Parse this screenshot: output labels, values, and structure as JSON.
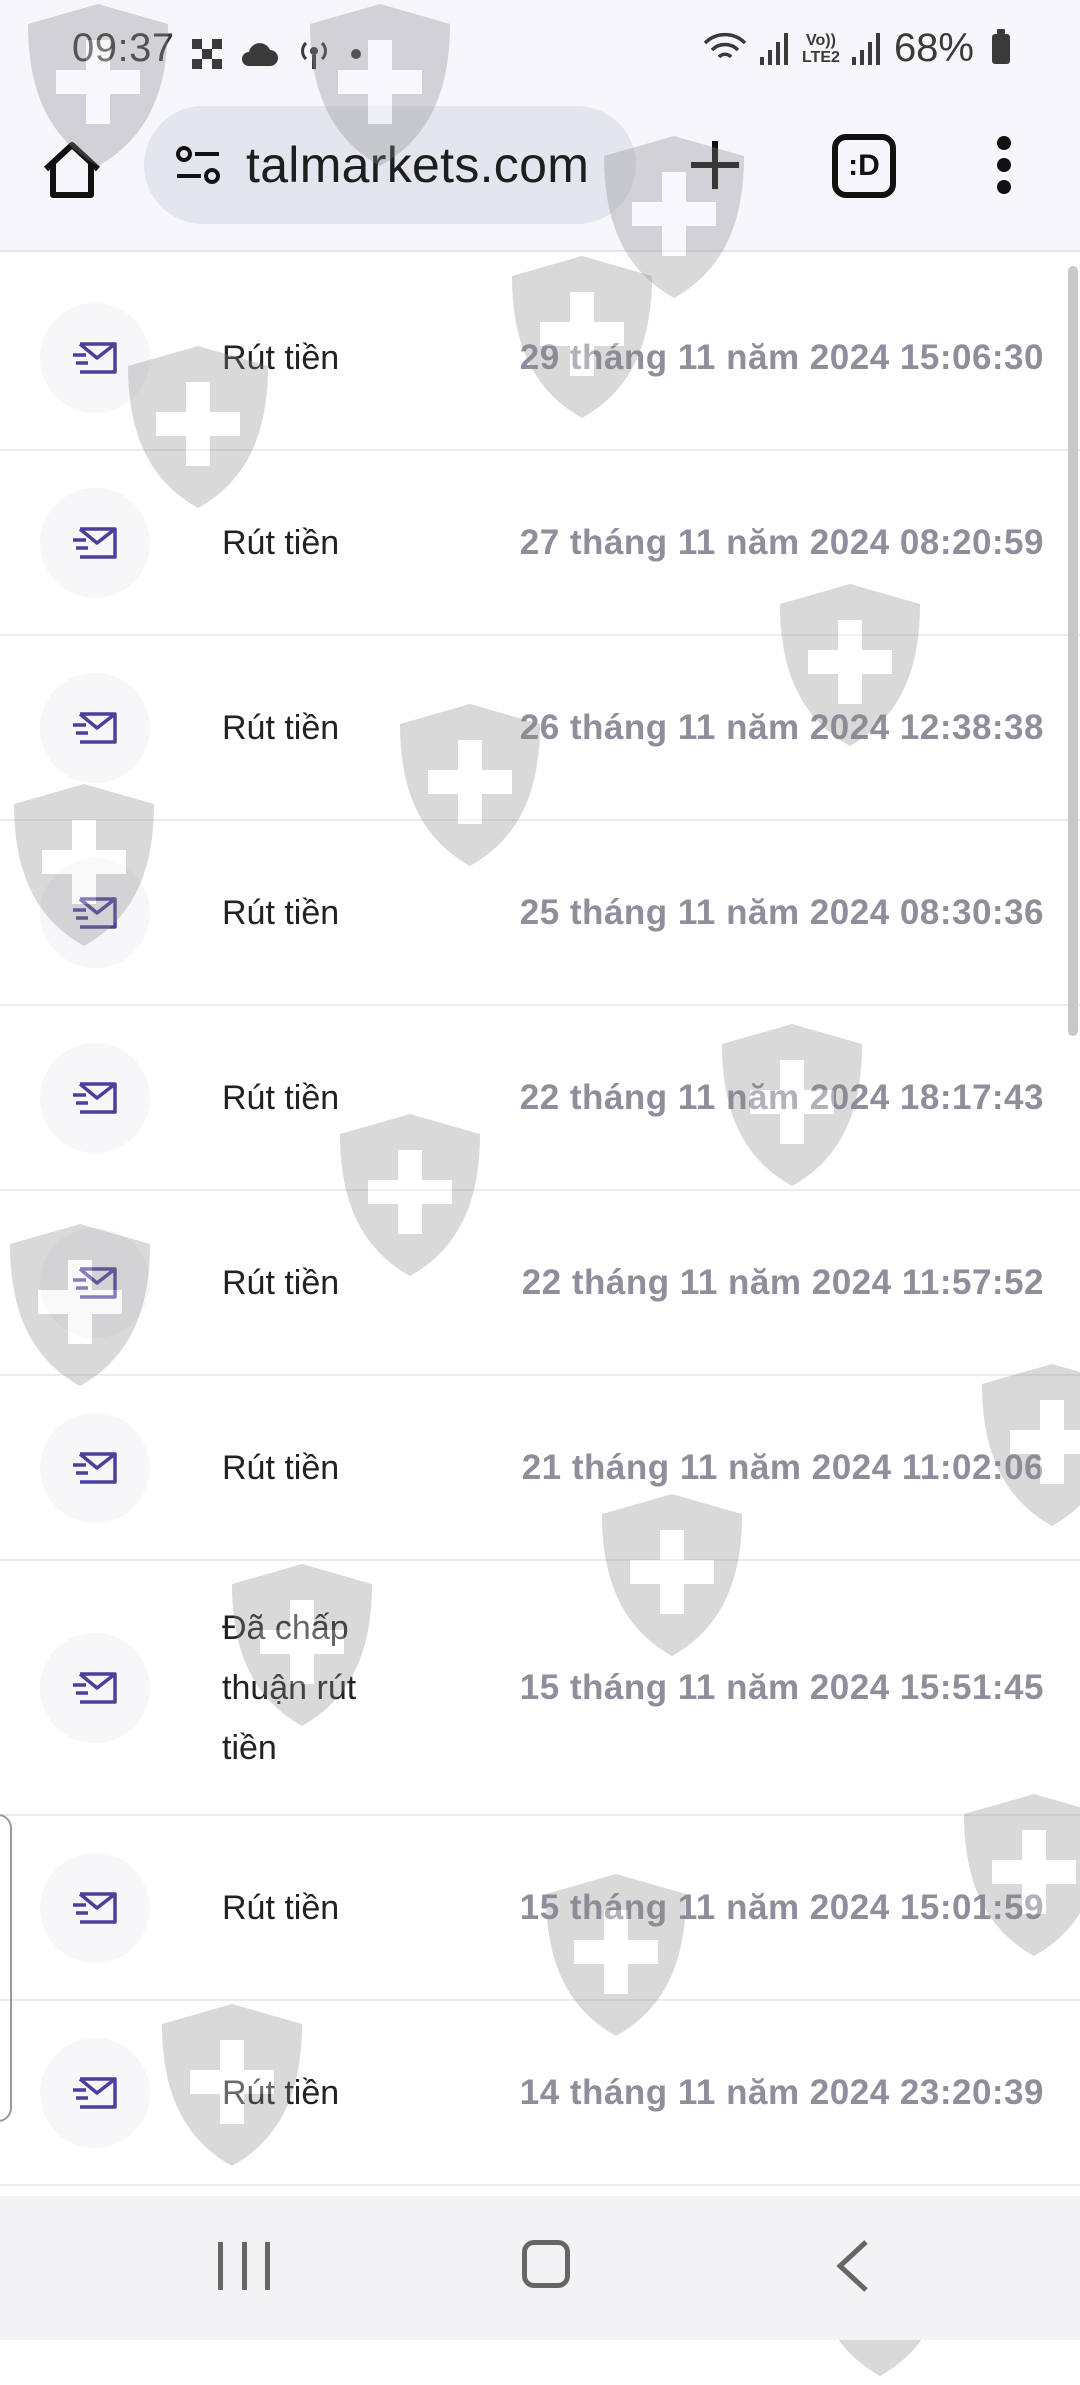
{
  "status_bar": {
    "time": "09:37",
    "battery": "68%",
    "network": "LTE2",
    "network_prefix": "Vo))"
  },
  "browser": {
    "url": "talmarkets.com",
    "tabs_badge": ":D",
    "icons": [
      "home-icon",
      "site-settings-icon",
      "plus-icon",
      "tabs-icon",
      "more-vert-icon"
    ]
  },
  "messages": [
    {
      "label": "Rút tiền",
      "date": "29 tháng 11 năm 2024 15:06:30"
    },
    {
      "label": "Rút tiền",
      "date": "27 tháng 11 năm 2024 08:20:59"
    },
    {
      "label": "Rút tiền",
      "date": "26 tháng 11 năm 2024 12:38:38"
    },
    {
      "label": "Rút tiền",
      "date": "25 tháng 11 năm 2024 08:30:36"
    },
    {
      "label": "Rút tiền",
      "date": "22 tháng 11 năm 2024 18:17:43"
    },
    {
      "label": "Rút tiền",
      "date": "22 tháng 11 năm 2024 11:57:52"
    },
    {
      "label": "Rút tiền",
      "date": "21 tháng 11 năm 2024 11:02:06"
    },
    {
      "label": "Đã chấp thuận rút tiền",
      "date": "15 tháng 11 năm 2024 15:51:45"
    },
    {
      "label": "Rút tiền",
      "date": "15 tháng 11 năm 2024 15:01:59"
    },
    {
      "label": "Rút tiền",
      "date": "14 tháng 11 năm 2024 23:20:39"
    }
  ],
  "colors": {
    "accent_icon": "#4b3f9c",
    "date_text": "#8e8e9c",
    "toolbar_bg": "#f6f6fb",
    "url_pill_bg": "#e4e6ef"
  }
}
